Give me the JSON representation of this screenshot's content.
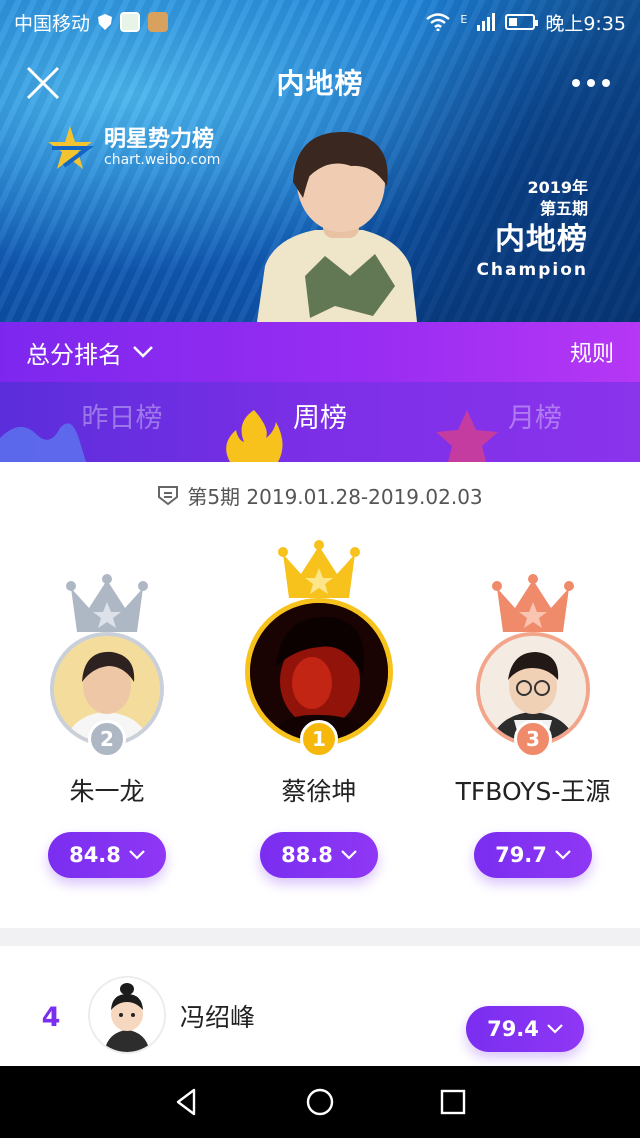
{
  "status_bar": {
    "carrier": "中国移动",
    "network": "E",
    "time": "晚上9:35"
  },
  "nav": {
    "title": "内地榜"
  },
  "banner": {
    "brand_name": "明星势力榜",
    "brand_url": "chart.weibo.com",
    "edition_year": "2019年",
    "edition_period": "第五期",
    "edition_title": "内地榜",
    "edition_subtitle": "Champion"
  },
  "ranking": {
    "mode_label": "总分排名",
    "rules_label": "规则"
  },
  "tabs": [
    {
      "label": "昨日榜",
      "active": false
    },
    {
      "label": "周榜",
      "active": true
    },
    {
      "label": "月榜",
      "active": false
    }
  ],
  "period": {
    "text": "第5期 2019.01.28-2019.02.03"
  },
  "podium": [
    {
      "rank": "1",
      "name": "蔡徐坤",
      "score": "88.8"
    },
    {
      "rank": "2",
      "name": "朱一龙",
      "score": "84.8"
    },
    {
      "rank": "3",
      "name": "TFBOYS-王源",
      "score": "79.7"
    }
  ],
  "list": [
    {
      "rank": "4",
      "name": "冯绍峰",
      "score": "79.4"
    }
  ],
  "colors": {
    "accent": "#7a2ef0",
    "gold": "#f7c21c",
    "silver": "#aeb7c4",
    "bronze": "#ef8a6a"
  }
}
